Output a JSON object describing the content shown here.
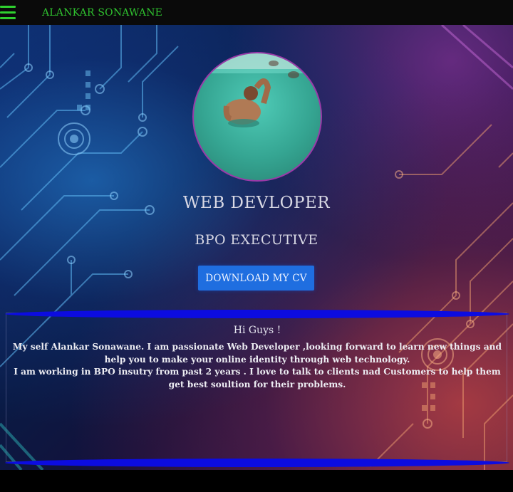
{
  "header": {
    "menu_icon": "hamburger-menu-icon",
    "brand": "ALANKAR SONAWANE"
  },
  "hero": {
    "profile_photo": "profile-photo",
    "role_primary": "WEB DEVLOPER",
    "role_secondary": "BPO EXECUTIVE",
    "download_button": "DOWNLOAD MY CV"
  },
  "about": {
    "greeting": "Hi Guys !",
    "line1": "My self Alankar Sonawane. I am passionate Web Developer ,looking forward to learn new things and help you to make your online identity through web technology.",
    "line2": "I am working in BPO insutry from past 2 years . I love to talk to clients nad Customers to help them get best soultion for their problems."
  },
  "colors": {
    "brand_green": "#2fc12f",
    "button_blue": "#1f6ee0",
    "ribbon_blue": "#0c0ce0",
    "avatar_border": "#9a3aa8"
  }
}
